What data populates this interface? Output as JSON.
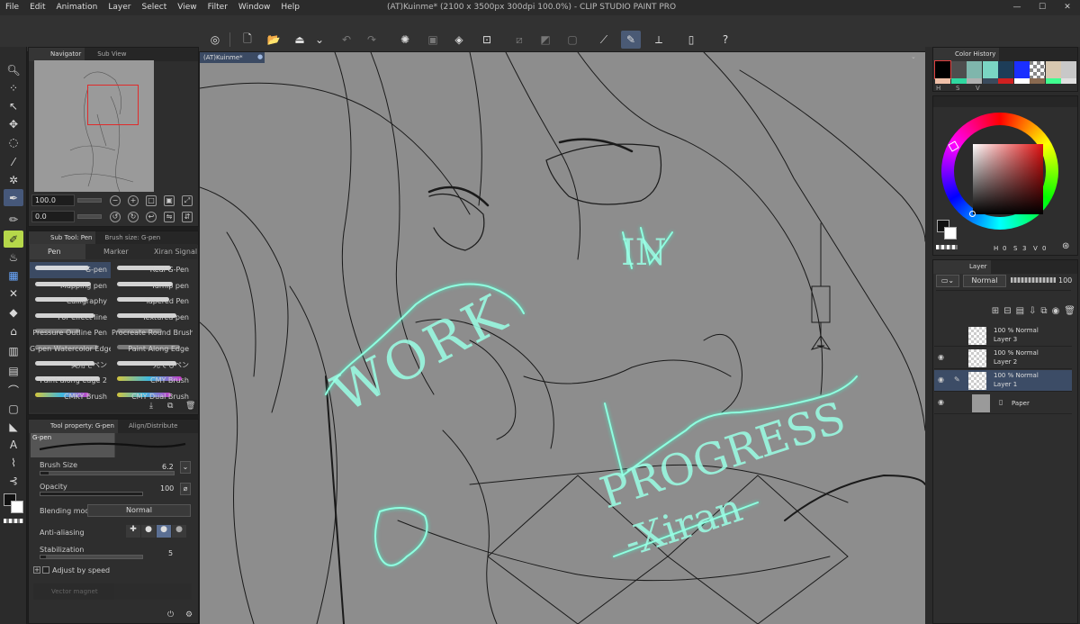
{
  "app": {
    "title": "(AT)Kuinme* (2100 x 3500px 300dpi 100.0%) - CLIP STUDIO PAINT PRO",
    "window_controls": [
      "—",
      "☐",
      "✕"
    ]
  },
  "menu": [
    "File",
    "Edit",
    "Animation",
    "Layer",
    "Select",
    "View",
    "Filter",
    "Window",
    "Help"
  ],
  "navigator": {
    "tabs": [
      "Navigator",
      "Sub View"
    ],
    "zoom_value": "100.0",
    "rotate_value": "0.0"
  },
  "subtool": {
    "tabs": [
      "Sub Tool: Pen",
      "Brush size: G-pen"
    ],
    "groups": [
      "Pen",
      "Marker",
      "Xiran Signal"
    ],
    "brushes": [
      "G-pen",
      "Real G-Pen",
      "Mapping pen",
      "Turnip pen",
      "Calligraphy",
      "Tapered Pen",
      "For effect line",
      "Textured pen",
      "Pressure Outline Pen",
      "Procreate Round Brush",
      "G-pen Watercolor Edge",
      "Paint Along Edge",
      "実用モペン",
      "死でもペン",
      "Paint along edge 2",
      "CMY Brush",
      "CMKY Brush",
      "CMY Dual Brush"
    ]
  },
  "tool_property": {
    "tabs": [
      "Tool property: G-pen",
      "Align/Distribute"
    ],
    "preview_label": "G-pen",
    "brush_size_label": "Brush Size",
    "brush_size_value": "6.2",
    "opacity_label": "Opacity",
    "opacity_value": "100",
    "blend_label": "Blending mode",
    "blend_value": "Normal",
    "aa_label": "Anti-aliasing",
    "stab_label": "Stabilization",
    "stab_value": "5",
    "adjust_label": "Adjust by speed",
    "vector_label": "Vector magnet"
  },
  "canvas": {
    "tab_label": "(AT)Kuinme*",
    "text_glow": [
      "WORK",
      "IN",
      "PROGRESS",
      "-Xiran"
    ]
  },
  "color_history": {
    "title": "Color History",
    "swatches": [
      "#000000",
      "#4e4e4e",
      "#7fb6ac",
      "#7ad5c3",
      "#1d3d58",
      "#1a2fff",
      "#cccccc",
      "#d8c8b0",
      "#c8c8c8",
      "#f0c0a8",
      "#2fd8a0",
      "#b0b0b0",
      "#3a4a5c",
      "#d02020",
      "#ffffff",
      "#8a6a50",
      "#40ff90",
      "#e0e0e0"
    ],
    "labels": [
      "H",
      "S",
      "V"
    ]
  },
  "color_wheel": {
    "readout": [
      "H",
      "0",
      "S",
      "3",
      "V",
      "0"
    ]
  },
  "layer_panel": {
    "tabs": [
      "Layer"
    ],
    "blend_mode": "Normal",
    "opacity": "100",
    "layers": [
      {
        "mode": "100 % Normal",
        "name": "Layer 3"
      },
      {
        "mode": "100 % Normal",
        "name": "Layer 2"
      },
      {
        "mode": "100 % Normal",
        "name": "Layer 1"
      },
      {
        "mode": "",
        "name": "Paper"
      }
    ]
  }
}
